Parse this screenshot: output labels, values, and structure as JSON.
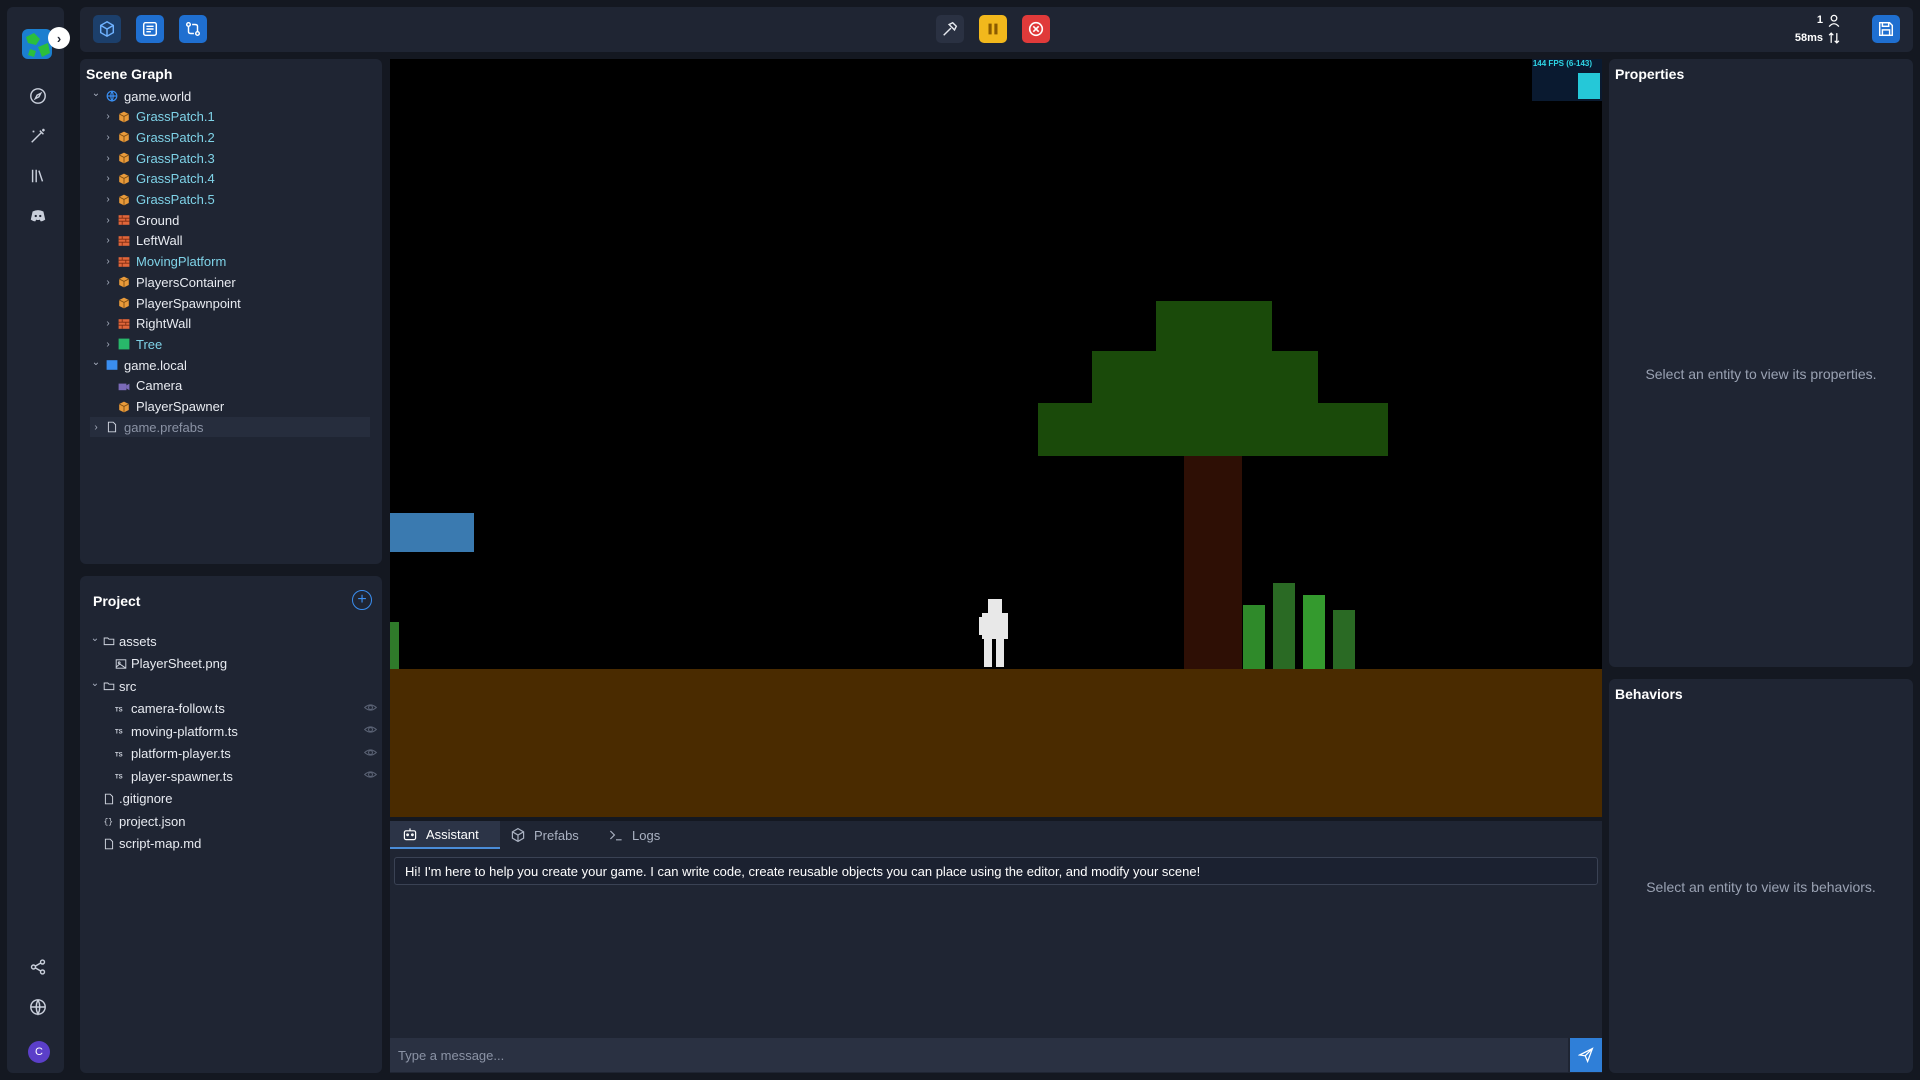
{
  "rail": {
    "items": [
      {
        "icon": "compass-icon"
      },
      {
        "icon": "magic-wand-icon"
      },
      {
        "icon": "library-icon"
      },
      {
        "icon": "discord-icon"
      }
    ],
    "bottom_items": [
      {
        "icon": "share-icon"
      },
      {
        "icon": "globe-icon"
      }
    ],
    "avatar_initial": "C"
  },
  "toolbar": {
    "left_buttons": [
      "cube-icon",
      "scene-icon",
      "git-compare-icon"
    ],
    "center_buttons": [
      "build-hammer-icon",
      "pause-icon",
      "stop-icon"
    ],
    "player_count": "1",
    "latency": "58ms"
  },
  "scene_graph": {
    "title": "Scene Graph",
    "rows": [
      {
        "label": "game.world",
        "depth": 0,
        "expanded": true,
        "icon": "globe-icon",
        "color": "white"
      },
      {
        "label": "GrassPatch.1",
        "depth": 1,
        "icon": "box-icon",
        "color": "cyan"
      },
      {
        "label": "GrassPatch.2",
        "depth": 1,
        "icon": "box-icon",
        "color": "cyan"
      },
      {
        "label": "GrassPatch.3",
        "depth": 1,
        "icon": "box-icon",
        "color": "cyan"
      },
      {
        "label": "GrassPatch.4",
        "depth": 1,
        "icon": "box-icon",
        "color": "cyan"
      },
      {
        "label": "GrassPatch.5",
        "depth": 1,
        "icon": "box-icon",
        "color": "cyan"
      },
      {
        "label": "Ground",
        "depth": 1,
        "icon": "brick-icon",
        "color": "white"
      },
      {
        "label": "LeftWall",
        "depth": 1,
        "icon": "brick-icon",
        "color": "white"
      },
      {
        "label": "MovingPlatform",
        "depth": 1,
        "icon": "brick-icon",
        "color": "cyan"
      },
      {
        "label": "PlayersContainer",
        "depth": 1,
        "icon": "box-icon",
        "color": "white"
      },
      {
        "label": "PlayerSpawnpoint",
        "depth": 1,
        "icon": "box-icon",
        "color": "white",
        "leaf": true
      },
      {
        "label": "RightWall",
        "depth": 1,
        "icon": "brick-icon",
        "color": "white"
      },
      {
        "label": "Tree",
        "depth": 1,
        "icon": "square-green-icon",
        "color": "cyan"
      },
      {
        "label": "game.local",
        "depth": 0,
        "expanded": true,
        "icon": "monitor-icon",
        "color": "white"
      },
      {
        "label": "Camera",
        "depth": 1,
        "icon": "camera-icon",
        "color": "white",
        "leaf": true
      },
      {
        "label": "PlayerSpawner",
        "depth": 1,
        "icon": "box-icon",
        "color": "white",
        "leaf": true
      },
      {
        "label": "game.prefabs",
        "depth": 0,
        "icon": "file-icon",
        "color": "dim"
      }
    ]
  },
  "project": {
    "title": "Project",
    "rows": [
      {
        "label": "assets",
        "depth": 0,
        "icon": "folder-icon",
        "expanded": true
      },
      {
        "label": "PlayerSheet.png",
        "depth": 1,
        "icon": "image-icon"
      },
      {
        "label": "src",
        "depth": 0,
        "icon": "folder-icon",
        "expanded": true
      },
      {
        "label": "camera-follow.ts",
        "depth": 1,
        "icon": "ts-icon",
        "eye": true
      },
      {
        "label": "moving-platform.ts",
        "depth": 1,
        "icon": "ts-icon",
        "eye": true
      },
      {
        "label": "platform-player.ts",
        "depth": 1,
        "icon": "ts-icon",
        "eye": true
      },
      {
        "label": "player-spawner.ts",
        "depth": 1,
        "icon": "ts-icon",
        "eye": true
      },
      {
        "label": ".gitignore",
        "depth": 0,
        "icon": "file-icon"
      },
      {
        "label": "project.json",
        "depth": 0,
        "icon": "json-icon"
      },
      {
        "label": "script-map.md",
        "depth": 0,
        "icon": "file-icon"
      }
    ]
  },
  "viewport": {
    "fps_text": "144 FPS (6-143)"
  },
  "properties": {
    "title": "Properties",
    "empty_text": "Select an entity to view its properties."
  },
  "behaviors": {
    "title": "Behaviors",
    "empty_text": "Select an entity to view its behaviors."
  },
  "assistant": {
    "tabs": [
      {
        "label": "Assistant",
        "icon": "robot-icon"
      },
      {
        "label": "Prefabs",
        "icon": "cube-icon"
      },
      {
        "label": "Logs",
        "icon": "terminal-icon"
      }
    ],
    "message": "Hi! I'm here to help you create your game. I can write code, create reusable objects you can place using the editor, and modify your scene!",
    "input_placeholder": "Type a message..."
  },
  "colors": {
    "accent": "#2f7fd8",
    "pause": "#f2b81c",
    "stop": "#e03a3a",
    "ground": "#4a2b00",
    "tree_leaves": "#1a4a0a",
    "tree_trunk": "#2e0f05",
    "platform": "#3a7ab0"
  }
}
